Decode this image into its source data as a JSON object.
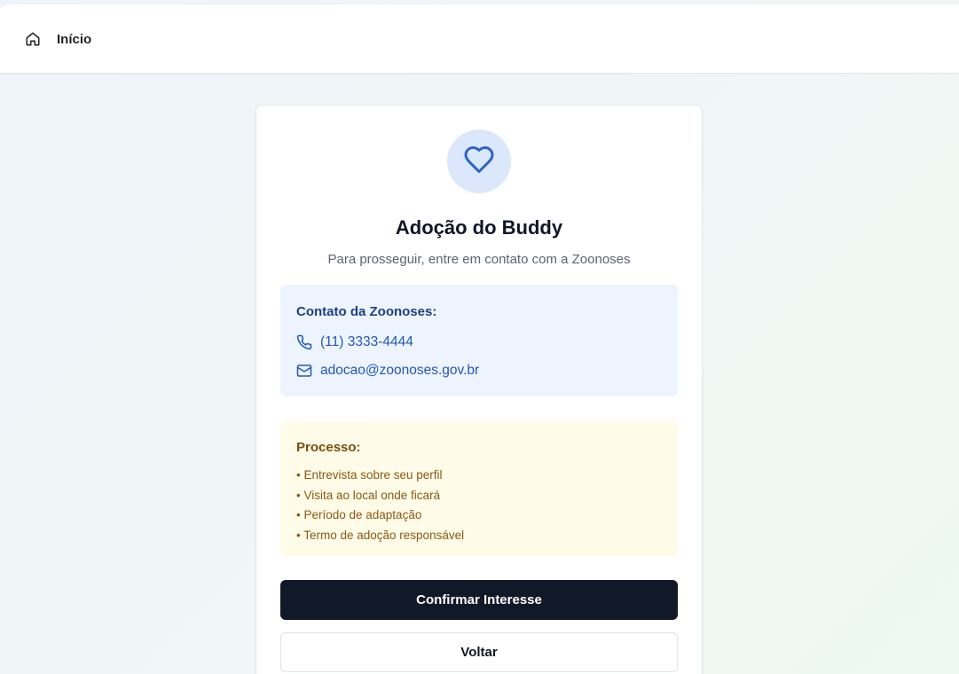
{
  "nav": {
    "home_label": "Início",
    "home_icon": "home-icon"
  },
  "card": {
    "icon": "heart-icon",
    "title": "Adoção do Buddy",
    "subtitle": "Para prosseguir, entre em contato com a Zoonoses",
    "contact": {
      "title": "Contato da Zoonoses:",
      "phone": "(11) 3333-4444",
      "phone_icon": "phone-icon",
      "email": "adocao@zoonoses.gov.br",
      "email_icon": "mail-icon"
    },
    "process": {
      "title": "Processo:",
      "items": [
        "• Entrevista sobre seu perfil",
        "• Visita ao local onde ficará",
        "• Período de adaptação",
        "• Termo de adoção responsável"
      ]
    },
    "confirm_label": "Confirmar Interesse",
    "back_label": "Voltar"
  },
  "colors": {
    "primary_button": "#111827",
    "contact_bg": "#edf4fe",
    "contact_text": "#2256b8",
    "process_bg": "#fefbe8",
    "process_text": "#8a5a12",
    "heart_bg": "#dbe8fb",
    "heart_stroke": "#2f63c6"
  }
}
